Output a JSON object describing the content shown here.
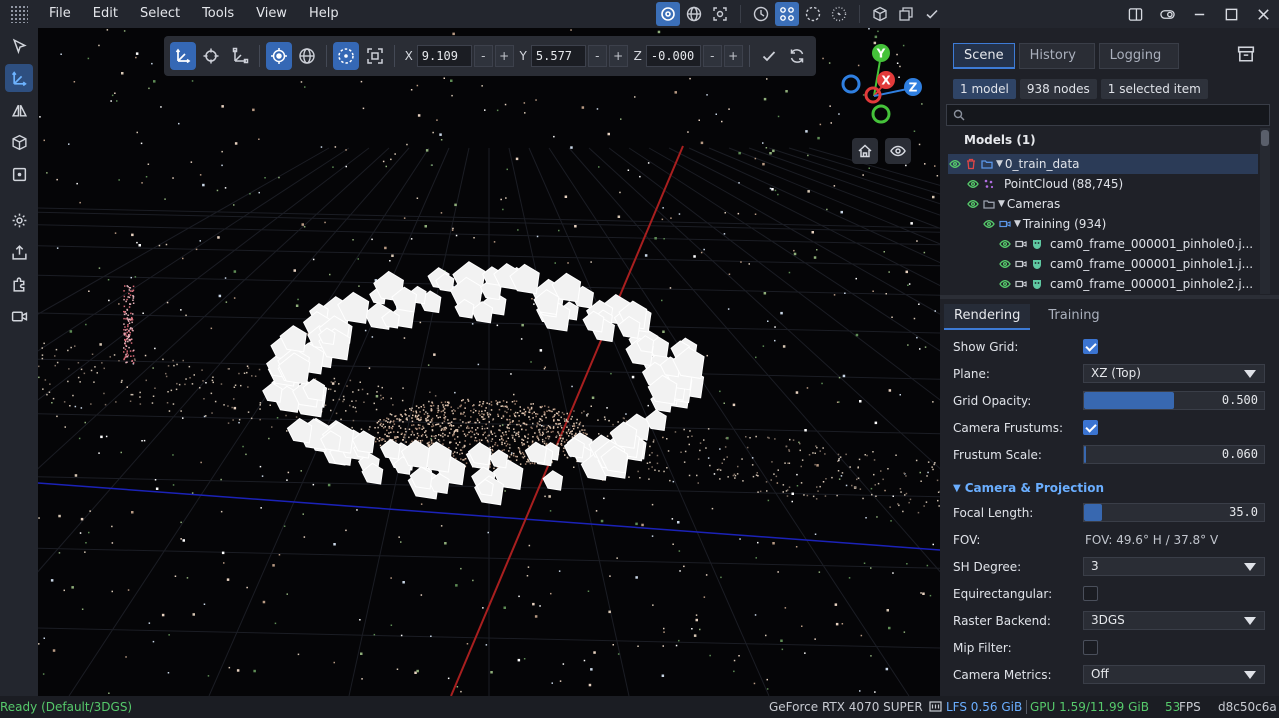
{
  "menubar": {
    "items": [
      "File",
      "Edit",
      "Select",
      "Tools",
      "View",
      "Help"
    ]
  },
  "top_tools": [
    "gizmo-local-icon",
    "globe-icon",
    "camera-target-icon",
    "clock-icon",
    "node-select-icon",
    "circle-dashed-icon",
    "circle-dotted-icon",
    "cube-icon",
    "windows-icon",
    "check-icon"
  ],
  "left_toolbar": [
    "select-arrow-icon",
    "translate-axes-icon",
    "mirror-icon",
    "cube-icon",
    "crop-icon",
    "settings-icon",
    "export-icon",
    "plugin-icon",
    "video-camera-icon"
  ],
  "gizmo": {
    "x_label": "X",
    "x_value": "9.109",
    "y_label": "Y",
    "y_value": "5.577",
    "z_label": "Z",
    "z_value": "-0.000",
    "minus": "-",
    "plus": "+"
  },
  "axes": {
    "y": "Y",
    "x": "X",
    "z": "Z"
  },
  "scene_tabs": [
    "Scene",
    "History",
    "Logging"
  ],
  "badges": [
    "1 model",
    "938 nodes",
    "1 selected item"
  ],
  "search": {
    "placeholder": ""
  },
  "models_header": "Models (1)",
  "tree": [
    {
      "label": "0_train_data"
    },
    {
      "label": "PointCloud (88,745)"
    },
    {
      "label": "Cameras"
    },
    {
      "label": "Training (934)"
    },
    {
      "label": "cam0_frame_000001_pinhole0.j..."
    },
    {
      "label": "cam0_frame_000001_pinhole1.j..."
    },
    {
      "label": "cam0_frame_000001_pinhole2.j..."
    }
  ],
  "render_tabs": [
    "Rendering",
    "Training"
  ],
  "props": {
    "show_grid": {
      "label": "Show Grid:",
      "checked": true
    },
    "plane": {
      "label": "Plane:",
      "value": "XZ (Top)"
    },
    "grid_opacity": {
      "label": "Grid Opacity:",
      "value": "0.500",
      "fraction": 0.5
    },
    "camera_frustums": {
      "label": "Camera Frustums:",
      "checked": true
    },
    "frustum_scale": {
      "label": "Frustum Scale:",
      "value": "0.060",
      "fraction": 0.01
    },
    "section": "Camera & Projection",
    "focal_length": {
      "label": "Focal Length:",
      "value": "35.0",
      "fraction": 0.1
    },
    "fov": {
      "label": "FOV:",
      "value": "FOV: 49.6° H / 37.8° V"
    },
    "sh_degree": {
      "label": "SH Degree:",
      "value": "3"
    },
    "equirectangular": {
      "label": "Equirectangular:",
      "checked": false
    },
    "raster_backend": {
      "label": "Raster Backend:",
      "value": "3DGS"
    },
    "mip_filter": {
      "label": "Mip Filter:",
      "checked": false
    },
    "camera_metrics": {
      "label": "Camera Metrics:",
      "value": "Off"
    }
  },
  "status": {
    "ready": "Ready (Default/3DGS)",
    "gpu_name": "GeForce RTX 4070 SUPER",
    "lfs": "LFS 0.56 GiB",
    "gpu": "GPU 1.59/11.99 GiB",
    "fps": "53",
    "fps_unit": "FPS",
    "hash": "d8c50c6a"
  },
  "colors": {
    "accent": "#3b74d1",
    "status_green": "#56c96b",
    "axis_x": "#e23a3a",
    "axis_y": "#45c23a",
    "axis_z": "#2f7fe0"
  }
}
